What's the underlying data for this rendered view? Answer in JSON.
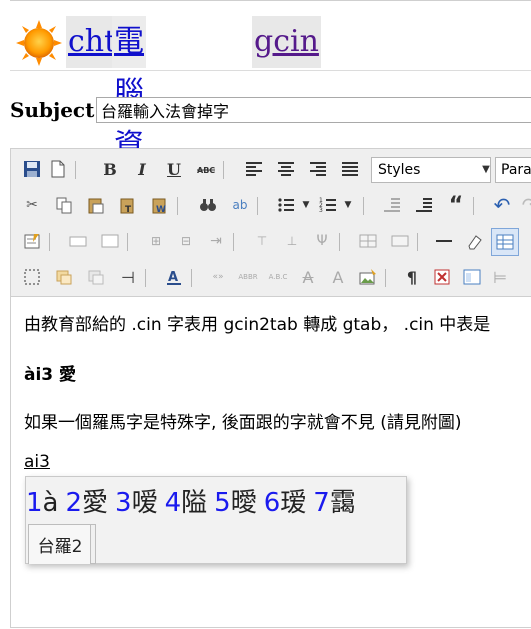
{
  "header": {
    "links": [
      "cht",
      "電腦資訊",
      "gcin"
    ]
  },
  "subject": {
    "label": "Subject:",
    "value": "台羅輸入法會掉字"
  },
  "toolbar": {
    "styles_label": "Styles",
    "format_label": "Para",
    "bold": "B",
    "italic": "I",
    "underline": "U"
  },
  "content": {
    "p1": "由教育部給的 .cin 字表用  gcin2tab 轉成 gtab， .cin 中表是",
    "p2": "ài3  愛",
    "p3": "如果一個羅馬字是特殊字, 後面跟的字就會不見 (請見附圖)",
    "p4": "ai3"
  },
  "candidates": {
    "items": [
      {
        "num": "1",
        "text": "à"
      },
      {
        "num": "2",
        "text": "愛"
      },
      {
        "num": "3",
        "text": "嗳"
      },
      {
        "num": "4",
        "text": "隘"
      },
      {
        "num": "5",
        "text": "曖"
      },
      {
        "num": "6",
        "text": "瑷"
      },
      {
        "num": "7",
        "text": "靄"
      }
    ],
    "status": "台羅2"
  }
}
